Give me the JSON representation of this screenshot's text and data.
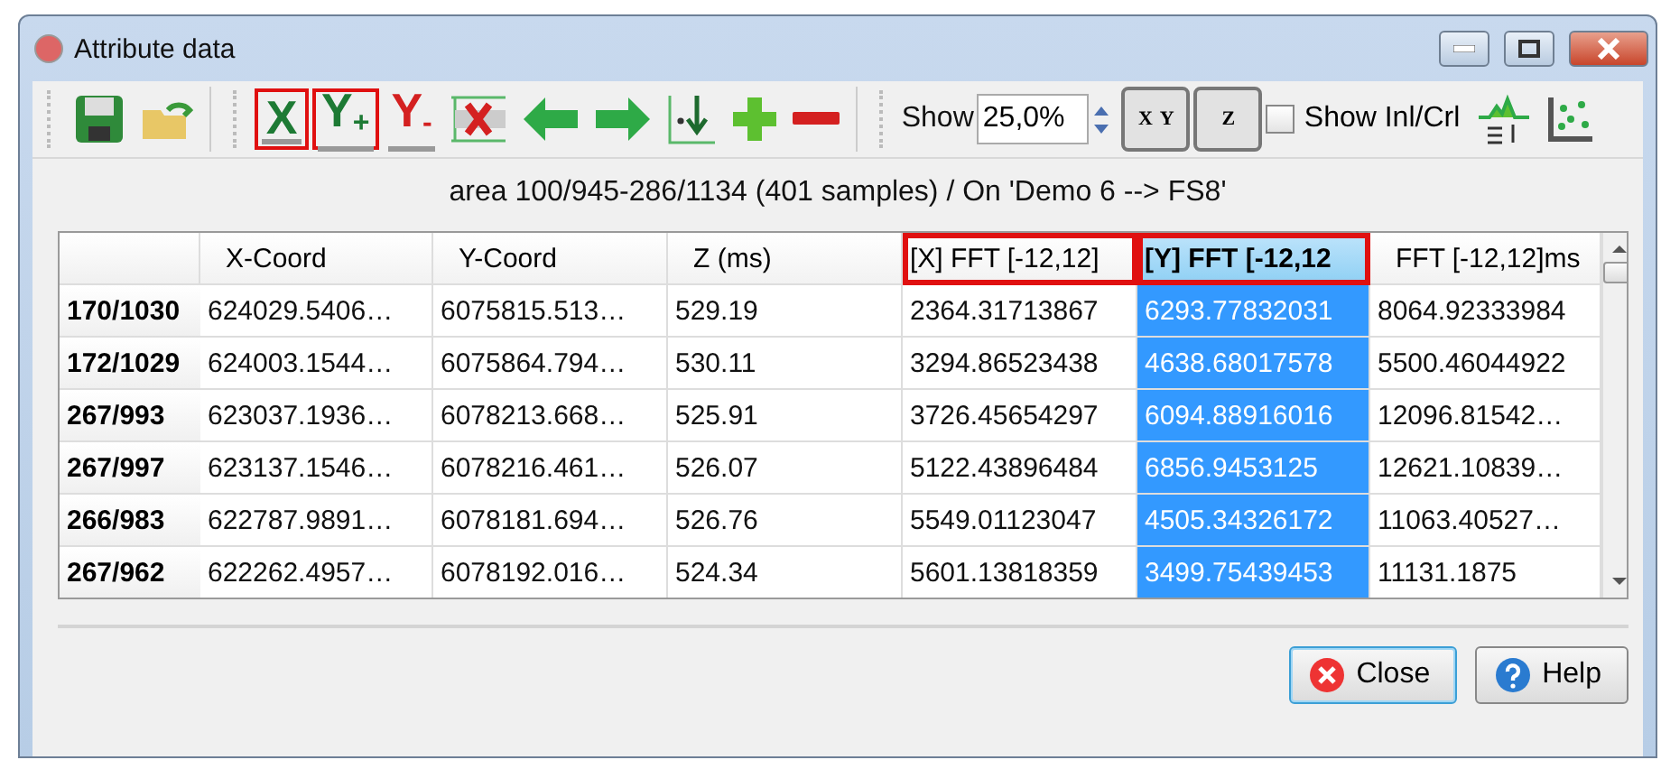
{
  "window": {
    "title": "Attribute data"
  },
  "toolbar": {
    "file_tools": [
      {
        "kind": "save"
      },
      {
        "kind": "open"
      }
    ],
    "edit_tools": [
      {
        "kind": "axis",
        "label": "X",
        "color": "#1d7a34",
        "outlined": true
      },
      {
        "kind": "axis",
        "label": "Y$_{+}$",
        "color": "#1d7a34",
        "outlined": true
      },
      {
        "kind": "axis",
        "label": "Y$_{-}$",
        "color": "#d42020",
        "outlined": false
      },
      {
        "kind": "delete"
      },
      {
        "kind": "left"
      },
      {
        "kind": "right"
      },
      {
        "kind": "insert"
      },
      {
        "kind": "add"
      },
      {
        "kind": "remove"
      }
    ],
    "show_label": "Show",
    "show_value": "25,0%",
    "toggles": [
      {
        "labels": [
          "X",
          "Y"
        ],
        "pressed": true
      },
      {
        "labels": [
          "Z"
        ],
        "pressed": true
      }
    ],
    "checkbox": {
      "label": "Show Inl/Crl",
      "checked": false
    },
    "view_tools": [
      {
        "kind": "profile"
      },
      {
        "kind": "scatter"
      }
    ]
  },
  "subtitle": "area 100/945-286/1134 (401 samples) / On 'Demo 6 --> FS8'",
  "table": {
    "columns": [
      {
        "label": "X-Coord",
        "selected": false,
        "outlined": false
      },
      {
        "label": "Y-Coord",
        "selected": false,
        "outlined": false
      },
      {
        "label": "Z (ms)",
        "selected": false,
        "outlined": false
      },
      {
        "label": "[X] FFT [-12,12]",
        "selected": false,
        "outlined": true
      },
      {
        "label": "[Y] FFT [-12,12",
        "selected": true,
        "outlined": true
      },
      {
        "label": "FFT [-12,12]ms",
        "selected": false,
        "outlined": false
      }
    ],
    "rows": [
      {
        "header": "170/1030",
        "cells": [
          "624029.5406…",
          "6075815.513…",
          "529.19",
          "2364.31713867",
          "6293.77832031",
          "8064.92333984"
        ]
      },
      {
        "header": "172/1029",
        "cells": [
          "624003.1544…",
          "6075864.794…",
          "530.11",
          "3294.86523438",
          "4638.68017578",
          "5500.46044922"
        ]
      },
      {
        "header": "267/993",
        "cells": [
          "623037.1936…",
          "6078213.668…",
          "525.91",
          "3726.45654297",
          "6094.88916016",
          "12096.81542…"
        ]
      },
      {
        "header": "267/997",
        "cells": [
          "623137.1546…",
          "6078216.461…",
          "526.07",
          "5122.43896484",
          "6856.9453125",
          "12621.10839…"
        ]
      },
      {
        "header": "266/983",
        "cells": [
          "622787.9891…",
          "6078181.694…",
          "526.76",
          "5549.01123047",
          "4505.34326172",
          "11063.40527…"
        ]
      },
      {
        "header": "267/962",
        "cells": [
          "622262.4957…",
          "6078192.016…",
          "524.34",
          "5601.13818359",
          "3499.75439453",
          "11131.1875"
        ]
      }
    ]
  },
  "buttons": [
    {
      "kind": "close",
      "label": "Close",
      "focused": true
    },
    {
      "kind": "help",
      "label": "Help",
      "focused": false
    }
  ]
}
